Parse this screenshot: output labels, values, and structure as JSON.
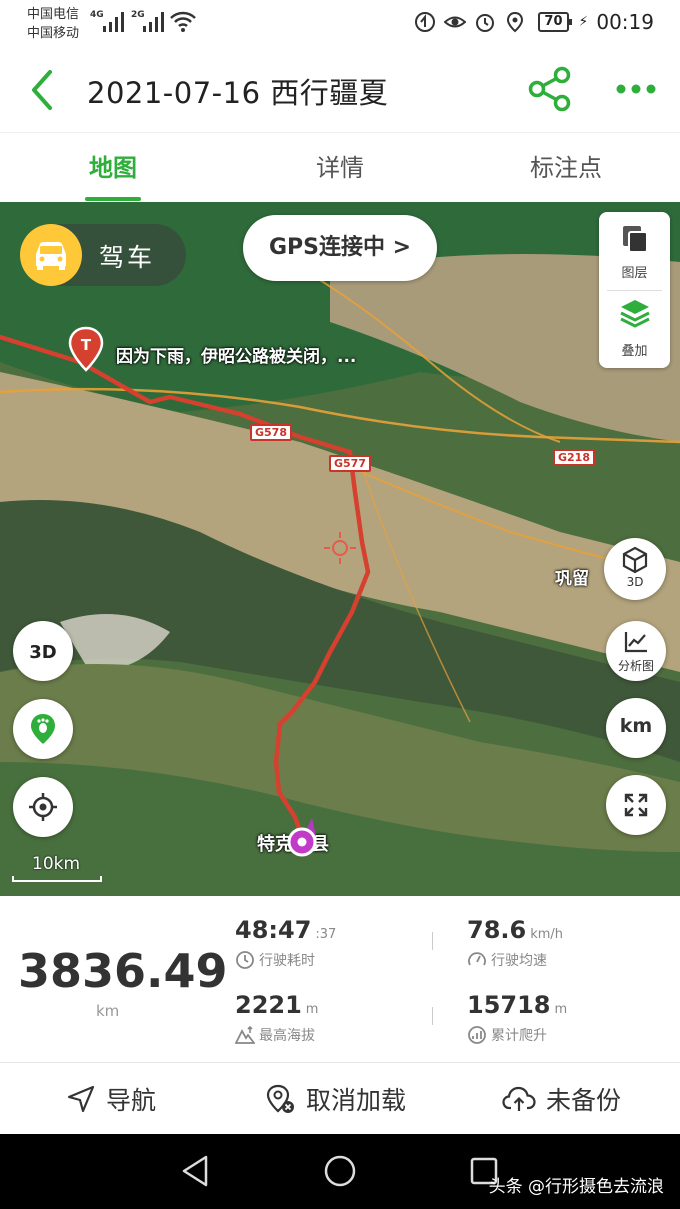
{
  "status_bar": {
    "carrier_1": "中国电信",
    "carrier_2": "中国移动",
    "net_1": "4G",
    "net_2": "2G",
    "battery": "70",
    "time": "00:19"
  },
  "header": {
    "title": "2021-07-16 西行疆夏",
    "back_icon": "chevron-left-icon",
    "share_icon": "share-icon",
    "more_icon": "more-dots-icon",
    "accent": "#2fae3b"
  },
  "tabs": [
    {
      "label": "地图",
      "active": true
    },
    {
      "label": "详情",
      "active": false
    },
    {
      "label": "标注点",
      "active": false
    }
  ],
  "map": {
    "mode_label": "驾车",
    "gps_status": "GPS连接中 >",
    "layer_label": "图层",
    "overlay_label": "叠加",
    "btn_3d_label": "3D",
    "btn_analysis_label": "分析图",
    "btn_km_label": "km",
    "annotation": "因为下雨，伊昭公路被关闭，...",
    "road_1": "G578",
    "road_2": "G577",
    "road_3": "G218",
    "place_1": "巩留",
    "place_2": "特克斯县",
    "scale": "10km",
    "route_color": "#d6402e"
  },
  "stats": {
    "distance": "3836.49",
    "distance_unit": "km",
    "duration": "48:47",
    "duration_sec": ":37",
    "duration_label": "行驶耗时",
    "avg_speed": "78.6",
    "avg_speed_unit": "km/h",
    "avg_speed_label": "行驶均速",
    "max_altitude": "2221",
    "max_altitude_unit": "m",
    "max_altitude_label": "最高海拔",
    "climb": "15718",
    "climb_unit": "m",
    "climb_label": "累计爬升"
  },
  "actions": {
    "navigate": "导航",
    "cancel_load": "取消加载",
    "backup": "未备份"
  },
  "watermark": "头条 @行形摄色去流浪"
}
